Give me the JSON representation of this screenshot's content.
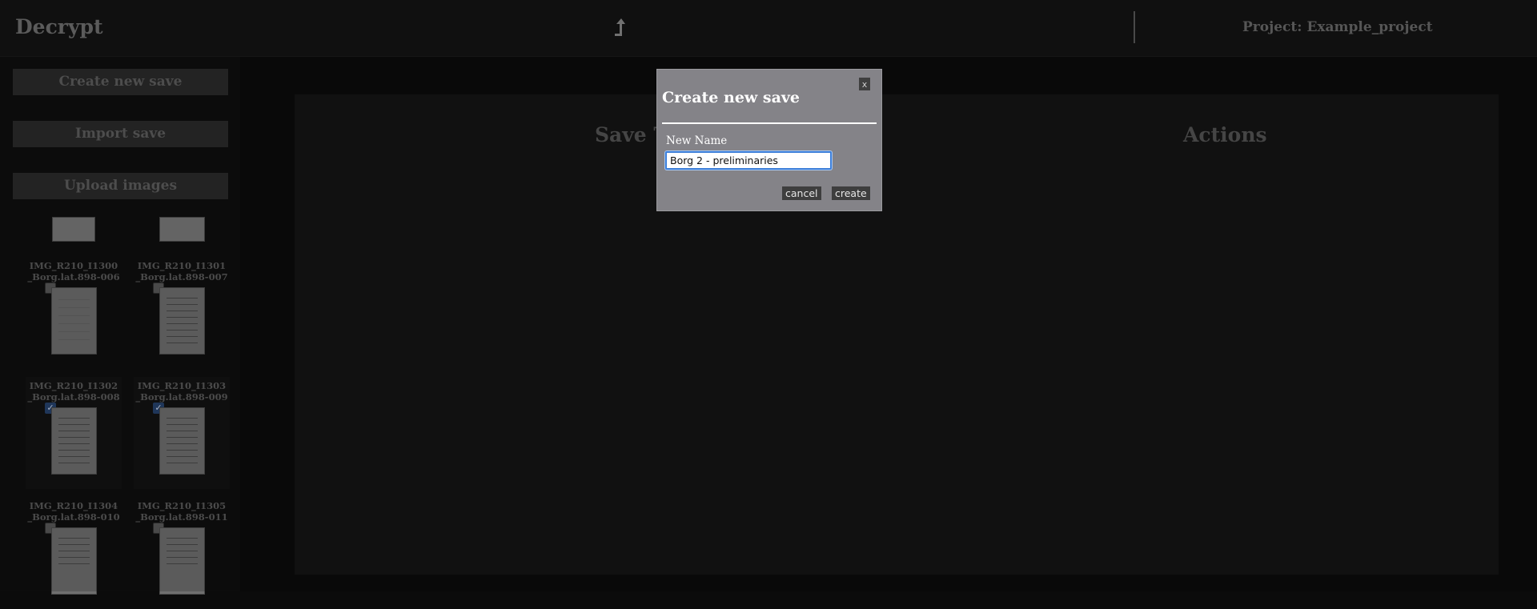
{
  "header": {
    "app_title": "Decrypt",
    "up_icon": "arrow-up-icon",
    "project_label": "Project: Example_project"
  },
  "sidebar": {
    "create_save_label": "Create new save",
    "import_save_label": "Import save",
    "upload_images_label": "Upload images",
    "images": [
      {
        "label": "IMG_R210_I1300\n_Borg.lat.898-006",
        "checked": false
      },
      {
        "label": "IMG_R210_I1301\n_Borg.lat.898-007",
        "checked": false
      },
      {
        "label": "IMG_R210_I1302\n_Borg.lat.898-008",
        "checked": true
      },
      {
        "label": "IMG_R210_I1303\n_Borg.lat.898-009",
        "checked": true
      },
      {
        "label": "IMG_R210_I1304\n_Borg.lat.898-010",
        "checked": false
      },
      {
        "label": "IMG_R210_I1305\n_Borg.lat.898-011",
        "checked": false
      }
    ]
  },
  "main": {
    "col_save_title": "Save T",
    "col_actions": "Actions"
  },
  "modal": {
    "title": "Create new save",
    "close_label": "x",
    "field_label": "New Name",
    "input_value": "Borg 2 - preliminaries",
    "cancel_label": "cancel",
    "create_label": "create"
  },
  "colors": {
    "accent_focus": "#3d7fd9",
    "checkbox_checked": "#27436d",
    "modal_bg": "#848388"
  }
}
